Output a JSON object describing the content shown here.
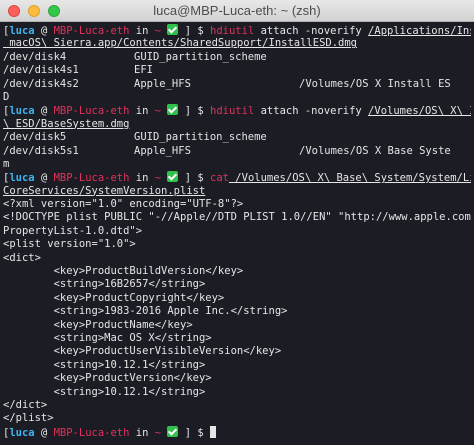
{
  "window": {
    "title": "luca@MBP-Luca-eth: ~ (zsh)"
  },
  "prompt": {
    "user": "luca",
    "sep": "@",
    "host": "MBP-Luca-eth",
    "in_word": "in",
    "dir": "~",
    "mark": "$"
  },
  "blocks": {
    "c1_cmd": "hdiutil",
    "c1_args": " attach -noverify ",
    "c1_path1": "/Applications/Install\\",
    "c1_path2": " macOS\\ Sierra.app/Contents/SharedSupport/InstallESD.dmg",
    "c1_out": [
      {
        "dev": "/dev/disk4",
        "scheme": "GUID_partition_scheme",
        "mount": ""
      },
      {
        "dev": "/dev/disk4s1",
        "scheme": "EFI",
        "mount": ""
      },
      {
        "dev": "/dev/disk4s2",
        "scheme": "Apple_HFS",
        "mount": "/Volumes/OS X Install ES"
      }
    ],
    "c1_wrap": "D",
    "c2_cmd": "hdiutil",
    "c2_args": " attach -noverify ",
    "c2_path1": "/Volumes/OS\\ X\\ Install",
    "c2_path2": "\\ ESD/BaseSystem.dmg",
    "c2_out": [
      {
        "dev": "/dev/disk5",
        "scheme": "GUID_partition_scheme",
        "mount": ""
      },
      {
        "dev": "/dev/disk5s1",
        "scheme": "Apple_HFS",
        "mount": "/Volumes/OS X Base Syste"
      }
    ],
    "c2_wrap": "m",
    "c3_cmd": "cat",
    "c3_path1": " /Volumes/OS\\ X\\ Base\\ System/System/Library/",
    "c3_path2": "CoreServices/SystemVersion.plist",
    "plist": [
      "<?xml version=\"1.0\" encoding=\"UTF-8\"?>",
      "<!DOCTYPE plist PUBLIC \"-//Apple//DTD PLIST 1.0//EN\" \"http://www.apple.com/DTDs/",
      "PropertyList-1.0.dtd\">",
      "<plist version=\"1.0\">",
      "<dict>",
      "        <key>ProductBuildVersion</key>",
      "        <string>16B2657</string>",
      "        <key>ProductCopyright</key>",
      "        <string>1983-2016 Apple Inc.</string>",
      "        <key>ProductName</key>",
      "        <string>Mac OS X</string>",
      "        <key>ProductUserVisibleVersion</key>",
      "        <string>10.12.1</string>",
      "        <key>ProductVersion</key>",
      "        <string>10.12.1</string>",
      "</dict>",
      "</plist>"
    ]
  }
}
